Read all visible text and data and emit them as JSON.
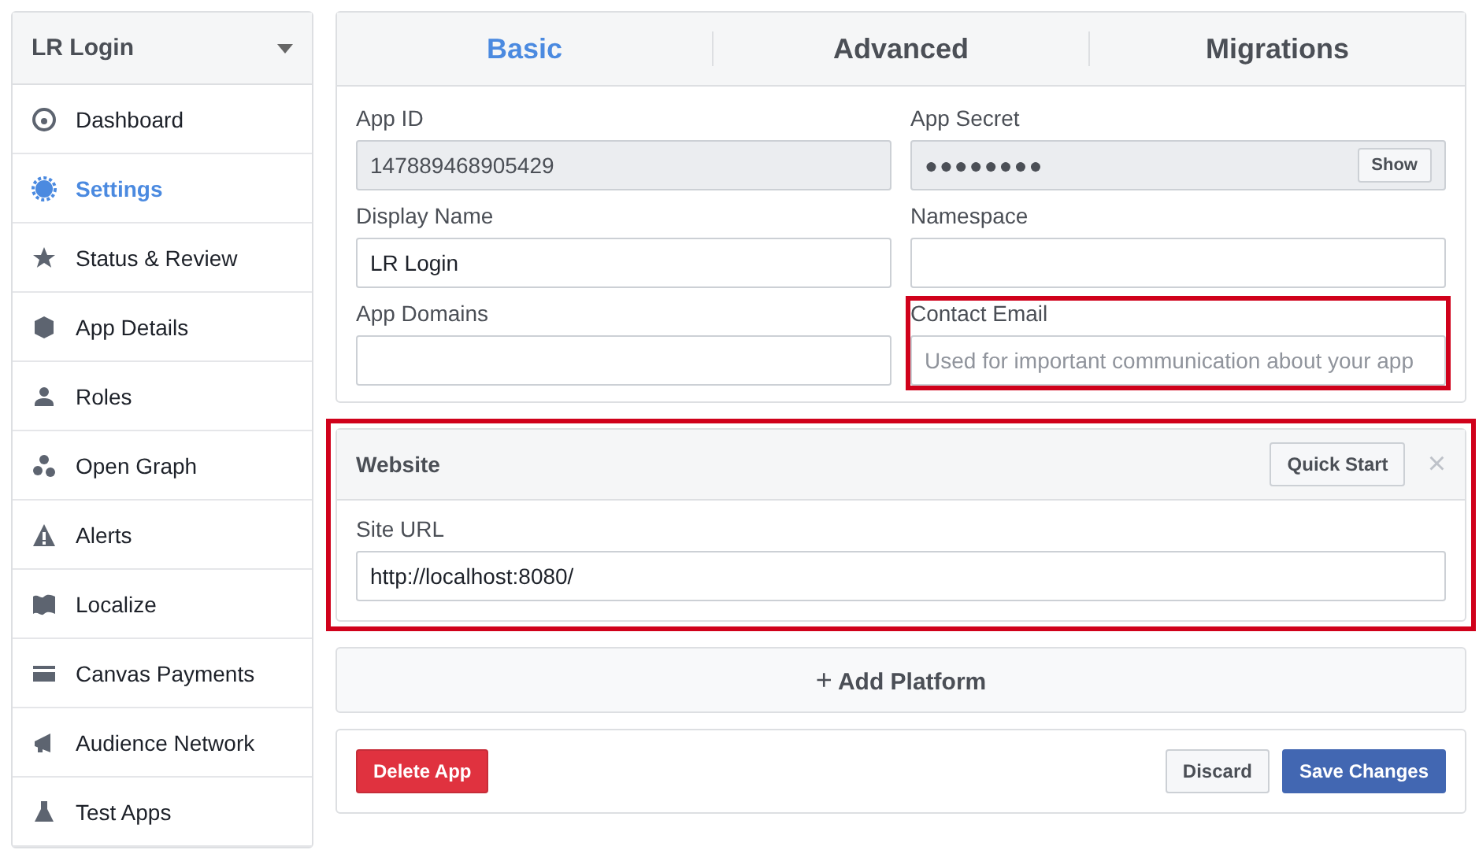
{
  "sidebar": {
    "app_name": "LR Login",
    "items": [
      {
        "label": "Dashboard",
        "selected": false
      },
      {
        "label": "Settings",
        "selected": true
      },
      {
        "label": "Status & Review",
        "selected": false
      },
      {
        "label": "App Details",
        "selected": false
      },
      {
        "label": "Roles",
        "selected": false
      },
      {
        "label": "Open Graph",
        "selected": false
      },
      {
        "label": "Alerts",
        "selected": false
      },
      {
        "label": "Localize",
        "selected": false
      },
      {
        "label": "Canvas Payments",
        "selected": false
      },
      {
        "label": "Audience Network",
        "selected": false
      },
      {
        "label": "Test Apps",
        "selected": false
      }
    ]
  },
  "tabs": [
    {
      "label": "Basic",
      "selected": true
    },
    {
      "label": "Advanced",
      "selected": false
    },
    {
      "label": "Migrations",
      "selected": false
    }
  ],
  "fields": [
    {
      "label": "App ID",
      "value": "147889468905429",
      "disabled": true,
      "highlighted": false
    },
    {
      "label": "App Secret",
      "value": "●●●●●●●●",
      "disabled": true,
      "highlighted": false,
      "button": "Show"
    },
    {
      "label": "Display Name",
      "value": "LR Login",
      "disabled": false,
      "highlighted": false
    },
    {
      "label": "Namespace",
      "disabled": false,
      "highlighted": false
    },
    {
      "label": "App Domains",
      "disabled": false,
      "highlighted": false
    },
    {
      "label": "Contact Email",
      "placeholder": "Used for important communication about your app",
      "disabled": false,
      "highlighted": true
    }
  ],
  "platform": {
    "title": "Website",
    "highlighted": true,
    "quick_start": "Quick Start",
    "close": "×",
    "field_label": "Site URL",
    "field_value": "http://localhost:8080/"
  },
  "add_platform": {
    "icon": "+",
    "label": "Add Platform"
  },
  "footer": {
    "delete": "Delete App",
    "discard": "Discard",
    "save": "Save Changes"
  }
}
